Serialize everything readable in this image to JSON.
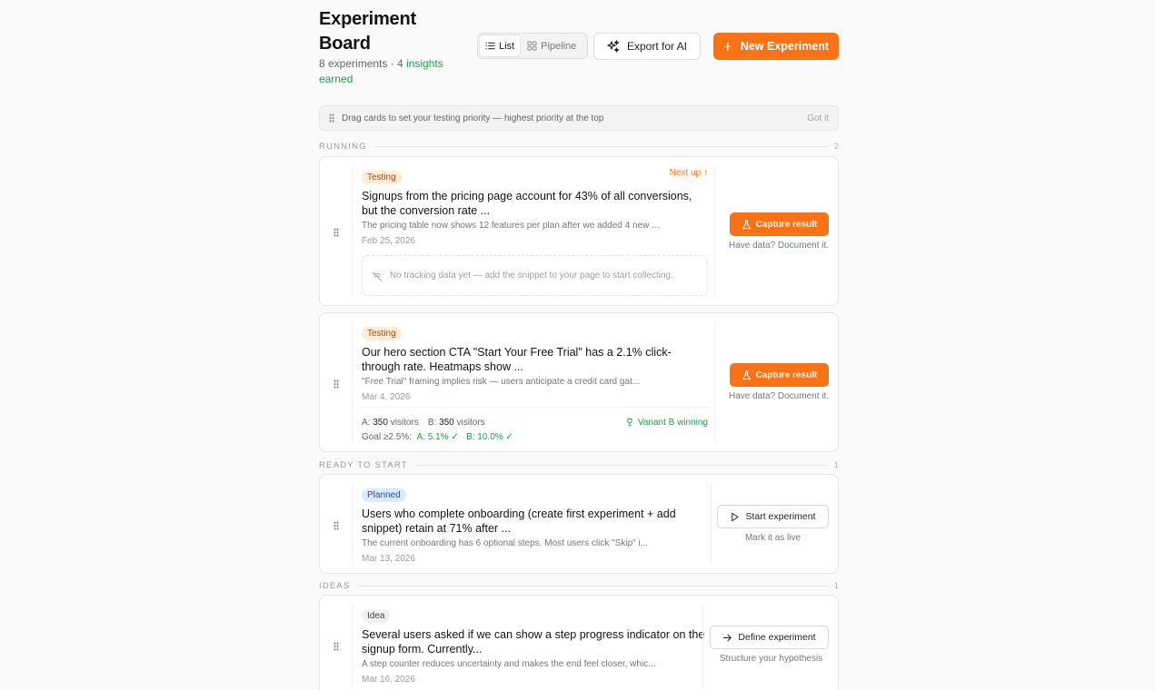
{
  "header": {
    "title": "Experiment Board",
    "count_text": "8 experiments · ",
    "insights_text": "4 insights earned",
    "view_list": "List",
    "view_pipeline": "Pipeline",
    "export_label": "Export for AI",
    "new_label": "New Experiment"
  },
  "hint": {
    "text": "Drag cards to set your testing priority — highest priority at the top",
    "dismiss": "Got it"
  },
  "sections": {
    "running": {
      "label": "RUNNING",
      "count": "2"
    },
    "ready": {
      "label": "READY TO START",
      "count": "1"
    },
    "ideas": {
      "label": "IDEAS",
      "count": "1"
    }
  },
  "cards": [
    {
      "badge": "Testing",
      "next_up": "Next up ↑",
      "title": "Signups from the pricing page account for 43% of all conversions, but the conversion rate ...",
      "desc": "The pricing table now shows 12 features per plan after we added 4 new ...",
      "date": "Feb 25, 2026",
      "tracking_empty": "No tracking data yet — add the snippet to your page to start collecting.",
      "action": "Capture result",
      "action_note": "Have data? Document it."
    },
    {
      "badge": "Testing",
      "title": "Our hero section CTA \"Start Your Free Trial\" has a 2.1% click-through rate. Heatmaps show ...",
      "desc": "\"Free Trial\" framing implies risk — users anticipate a credit card gat...",
      "date": "Mar 4, 2026",
      "variant_a_label": "A:",
      "variant_a_value": "350",
      "variant_a_unit": "visitors",
      "variant_b_label": "B:",
      "variant_b_value": "350",
      "variant_b_unit": "visitors",
      "winner": "Variant B winning",
      "goal": "Goal ≥2.5%:",
      "result_a": "A: 5.1% ✓",
      "result_b": "B: 10.0% ✓",
      "action": "Capture result",
      "action_note": "Have data? Document it."
    },
    {
      "badge": "Planned",
      "title": "Users who complete onboarding (create first experiment + add snippet) retain at 71% after ...",
      "desc": "The current onboarding has 6 optional steps. Most users click \"Skip\" i...",
      "date": "Mar 13, 2026",
      "action": "Start experiment",
      "action_note": "Mark it as live"
    },
    {
      "badge": "Idea",
      "title": "Several users asked if we can show a step progress indicator on the signup form. Currently...",
      "desc": "A step counter reduces uncertainty and makes the end feel closer, whic...",
      "date": "Mar 16, 2026",
      "action": "Define experiment",
      "action_note": "Structure your hypothesis"
    }
  ],
  "colors": {
    "accent": "#f97316",
    "success": "#16a34a"
  }
}
